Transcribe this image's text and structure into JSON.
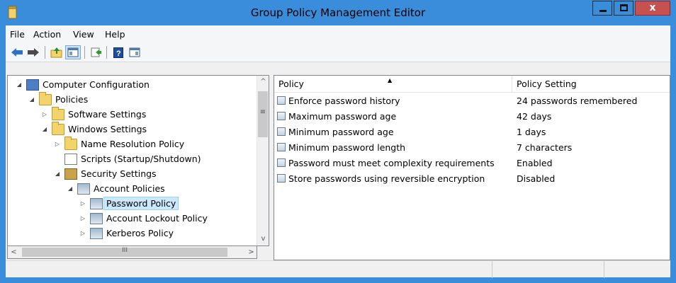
{
  "window": {
    "title": "Group Policy Management Editor",
    "accent": "#3a8ddb",
    "close_color": "#c75050",
    "controls": {
      "minimize": "minimize-icon",
      "maximize": "maximize-icon",
      "close_glyph": "x"
    }
  },
  "menu": {
    "file": "File",
    "action": "Action",
    "view": "View",
    "help": "Help"
  },
  "toolbar": {
    "icons": [
      "back-arrow-icon",
      "forward-arrow-icon",
      "up-folder-icon",
      "show-hide-tree-icon",
      "export-list-icon",
      "help-icon",
      "properties-icon"
    ],
    "help_glyph": "?"
  },
  "tree": {
    "items": [
      {
        "label": "Computer Configuration",
        "expander": "◢",
        "icon": "computer-icon"
      },
      {
        "label": "Policies",
        "expander": "◢",
        "icon": "folder-icon"
      },
      {
        "label": "Software Settings",
        "expander": "▷",
        "icon": "folder-icon"
      },
      {
        "label": "Windows Settings",
        "expander": "◢",
        "icon": "folder-icon"
      },
      {
        "label": "Name Resolution Policy",
        "expander": "▷",
        "icon": "folder-icon"
      },
      {
        "label": "Scripts (Startup/Shutdown)",
        "expander": "",
        "icon": "script-icon"
      },
      {
        "label": "Security Settings",
        "expander": "◢",
        "icon": "security-icon"
      },
      {
        "label": "Account Policies",
        "expander": "◢",
        "icon": "policy-icon"
      },
      {
        "label": "Password Policy",
        "expander": "▷",
        "icon": "policy-icon",
        "selected": true
      },
      {
        "label": "Account Lockout Policy",
        "expander": "▷",
        "icon": "policy-icon"
      },
      {
        "label": "Kerberos Policy",
        "expander": "▷",
        "icon": "policy-icon"
      }
    ],
    "scroll": {
      "up": "^",
      "down": "v",
      "left": "<",
      "right": ">",
      "grip": "≡",
      "hgrip": "III"
    }
  },
  "list": {
    "columns": {
      "policy": "Policy",
      "setting": "Policy Setting"
    },
    "sort_indicator": "▲",
    "rows": [
      {
        "policy": "Enforce password history",
        "setting": "24 passwords remembered"
      },
      {
        "policy": "Maximum password age",
        "setting": "42 days"
      },
      {
        "policy": "Minimum password age",
        "setting": "1 days"
      },
      {
        "policy": "Minimum password length",
        "setting": "7 characters"
      },
      {
        "policy": "Password must meet complexity requirements",
        "setting": "Enabled"
      },
      {
        "policy": "Store passwords using reversible encryption",
        "setting": "Disabled"
      }
    ]
  }
}
